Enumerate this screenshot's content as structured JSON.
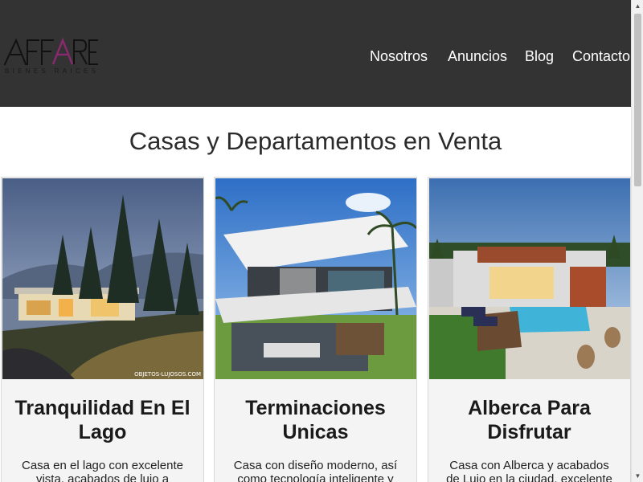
{
  "header": {
    "logo_text": "AFFARE",
    "logo_subtitle": "BIENES RAICES",
    "nav": [
      {
        "label": "Nosotros"
      },
      {
        "label": "Anuncios"
      },
      {
        "label": "Blog"
      },
      {
        "label": "Contacto"
      }
    ]
  },
  "main": {
    "title": "Casas y Departamentos en Venta",
    "cards": [
      {
        "image_watermark": "OBJETOS-LUJOSOS.COM",
        "title": "Tranquilidad En El Lago",
        "description": "Casa en el lago con excelente vista, acabados de lujo a"
      },
      {
        "title": "Terminaciones Unicas",
        "description": "Casa con diseño moderno, así como tecnología inteligente y"
      },
      {
        "title": "Alberca Para Disfrutar",
        "description": "Casa con Alberca y acabados de Lujo en la ciudad, excelente"
      }
    ]
  },
  "colors": {
    "header_bg": "#333333",
    "logo_accent": "#8a2a6e",
    "card_bg": "#f4f4f4"
  }
}
